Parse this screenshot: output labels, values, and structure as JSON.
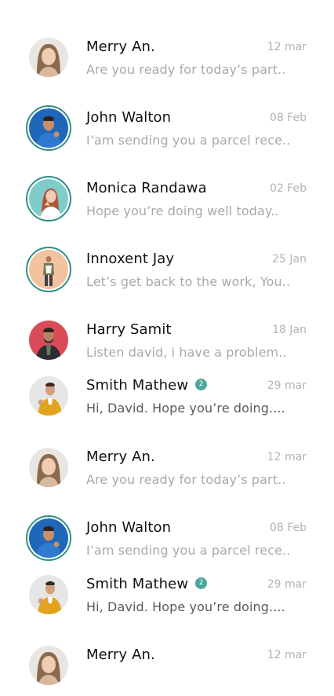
{
  "chats": [
    {
      "name": "Merry An.",
      "preview": "Are you ready for today’s part..",
      "date": "12 mar",
      "avatar": "woman-portrait",
      "ring": false,
      "badge": null,
      "unread": false
    },
    {
      "name": "John Walton",
      "preview": "I’am sending you a parcel rece..",
      "date": "08 Feb",
      "avatar": "man-blue-sweater",
      "ring": true,
      "badge": null,
      "unread": false
    },
    {
      "name": "Monica Randawa",
      "preview": "Hope you’re doing well today..",
      "date": "02 Feb",
      "avatar": "woman-teal-bg",
      "ring": true,
      "badge": null,
      "unread": false
    },
    {
      "name": "Innoxent Jay",
      "preview": "Let’s get back to the work, You..",
      "date": "25 Jan",
      "avatar": "man-standing-peach-bg",
      "ring": true,
      "badge": null,
      "unread": false
    },
    {
      "name": "Harry Samit",
      "preview": "Listen david, i have a problem..",
      "date": "18 Jan",
      "avatar": "man-red-bg",
      "ring": false,
      "badge": null,
      "unread": false
    },
    {
      "name": "Smith Mathew",
      "preview": "Hi, David. Hope you’re doing....",
      "date": "29 mar",
      "avatar": "man-yellow-shirt",
      "ring": false,
      "badge": "2",
      "unread": true
    },
    {
      "name": "Merry An.",
      "preview": "Are you ready for today’s part..",
      "date": "12 mar",
      "avatar": "woman-portrait",
      "ring": false,
      "badge": null,
      "unread": false
    },
    {
      "name": "John Walton",
      "preview": "I’am sending you a parcel rece..",
      "date": "08 Feb",
      "avatar": "man-blue-sweater",
      "ring": true,
      "badge": null,
      "unread": false
    },
    {
      "name": "Smith Mathew",
      "preview": "Hi, David. Hope you’re doing....",
      "date": "29 mar",
      "avatar": "man-yellow-shirt",
      "ring": false,
      "badge": "2",
      "unread": true
    },
    {
      "name": "Merry An.",
      "preview": "",
      "date": "12 mar",
      "avatar": "woman-portrait",
      "ring": false,
      "badge": null,
      "unread": false
    }
  ],
  "colors": {
    "ring": "#2f8f86",
    "badge": "#4aa79a",
    "name": "#111111",
    "preview": "#a9a9a9",
    "preview_unread": "#5a5a5a",
    "date": "#b3b3b3"
  }
}
